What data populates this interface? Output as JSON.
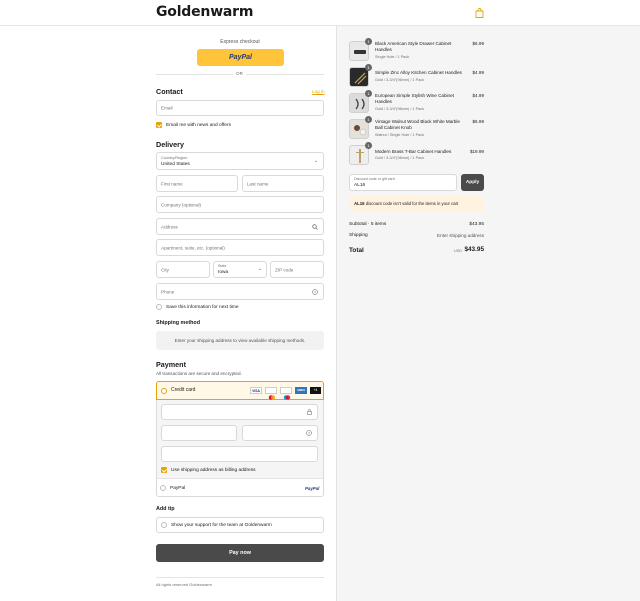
{
  "brand": {
    "name": "Goldenwarm"
  },
  "express": {
    "label": "Express checkout",
    "paypal": "PayPal",
    "or": "OR"
  },
  "contact": {
    "title": "Contact",
    "login": "Log in",
    "email_placeholder": "Email",
    "news_label": "Email me with news and offers"
  },
  "delivery": {
    "title": "Delivery",
    "country_label": "Country/Region",
    "country_value": "United States",
    "first_name": "First name",
    "last_name": "Last name",
    "company": "Company (optional)",
    "address": "Address",
    "apartment": "Apartment, suite, etc. (optional)",
    "city": "City",
    "state_label": "State",
    "state_value": "Iowa",
    "zip": "ZIP code",
    "phone": "Phone",
    "save_label": "Save this information for next time"
  },
  "shipping_method": {
    "title": "Shipping method",
    "notice": "Enter your shipping address to view available shipping methods."
  },
  "payment": {
    "title": "Payment",
    "subtitle": "All transactions are secure and encrypted.",
    "credit_card": "Credit card",
    "billing_label": "Use shipping address as billing address",
    "paypal_option": "PayPal",
    "paypal_logo": "PayPal",
    "card_brands": [
      "VISA",
      "MC",
      "MAE",
      "AMEX",
      "+4"
    ]
  },
  "tip": {
    "title": "Add tip",
    "label": "Show your support for the team at Goldenwarm"
  },
  "pay_button": "Pay now",
  "footer": "All rights reserved Goldenwarm",
  "order": {
    "items": [
      {
        "qty": "1",
        "name": "Black American Style Drawer Cabinet Handles",
        "variant": "Single Hole / 1 Pack",
        "price": "$6.99"
      },
      {
        "qty": "1",
        "name": "Simple Zinc Alloy Kitchen Cabinet Handles",
        "variant": "Gold / 3-3/4\"(96mm) / 1 Pack",
        "price": "$4.99"
      },
      {
        "qty": "1",
        "name": "European Simple Stylish Wine Cabinet Handles",
        "variant": "Gold / 3-3/4\"(96mm) / 1 Pack",
        "price": "$4.99"
      },
      {
        "qty": "1",
        "name": "Vintage Walnut Wood Black White Marble Ball Cabinet Knob",
        "variant": "Walnut / Single Hole / 1 Pack",
        "price": "$6.99"
      },
      {
        "qty": "1",
        "name": "Modern Brass T-Bar Cabinet Handles",
        "variant": "Gold / 3-3/4\"(96mm) / 1 Pack",
        "price": "$19.99"
      }
    ],
    "discount_label": "Discount code or gift card",
    "discount_value": "AL16",
    "apply": "Apply",
    "discount_error_code": "AL16",
    "discount_error_text": "discount code isn't valid for the items in your cart",
    "subtotal_label": "Subtotal · 5 items",
    "subtotal_value": "$43.95",
    "shipping_label": "Shipping",
    "shipping_value": "Enter shipping address",
    "total_label": "Total",
    "currency": "USD",
    "total_value": "$43.95"
  },
  "colors": {
    "accent": "#e8a406",
    "paypal_yellow": "#ffc439",
    "button_dark": "#4a4a4a"
  }
}
